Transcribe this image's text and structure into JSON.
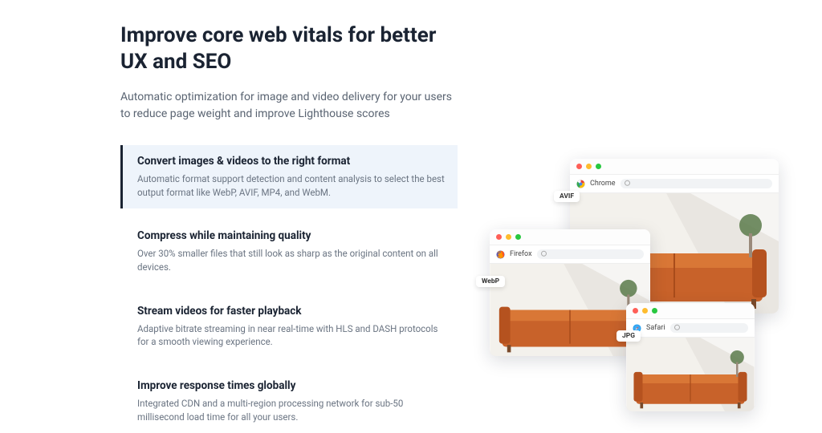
{
  "hero": {
    "title": "Improve core web vitals for better UX and SEO",
    "subtitle": "Automatic optimization for image and video delivery for your users to reduce page weight and improve Lighthouse scores"
  },
  "features": [
    {
      "title": "Convert images & videos to the right format",
      "desc": "Automatic format support detection and content analysis to select the best output format like WebP, AVIF, MP4, and WebM.",
      "active": true
    },
    {
      "title": "Compress while maintaining quality",
      "desc": "Over 30% smaller files that still look as sharp as the original content on all devices.",
      "active": false
    },
    {
      "title": "Stream videos for faster playback",
      "desc": "Adaptive bitrate streaming in near real-time with HLS and DASH protocols for a smooth viewing experience.",
      "active": false
    },
    {
      "title": "Improve response times globally",
      "desc": "Integrated CDN and a multi-region processing network for sub-50 millisecond load time for all your users.",
      "active": false
    }
  ],
  "windows": {
    "chrome": {
      "browser": "Chrome",
      "badge": "AVIF"
    },
    "firefox": {
      "browser": "Firefox",
      "badge": "WebP"
    },
    "safari": {
      "browser": "Safari",
      "badge": "JPG"
    }
  }
}
